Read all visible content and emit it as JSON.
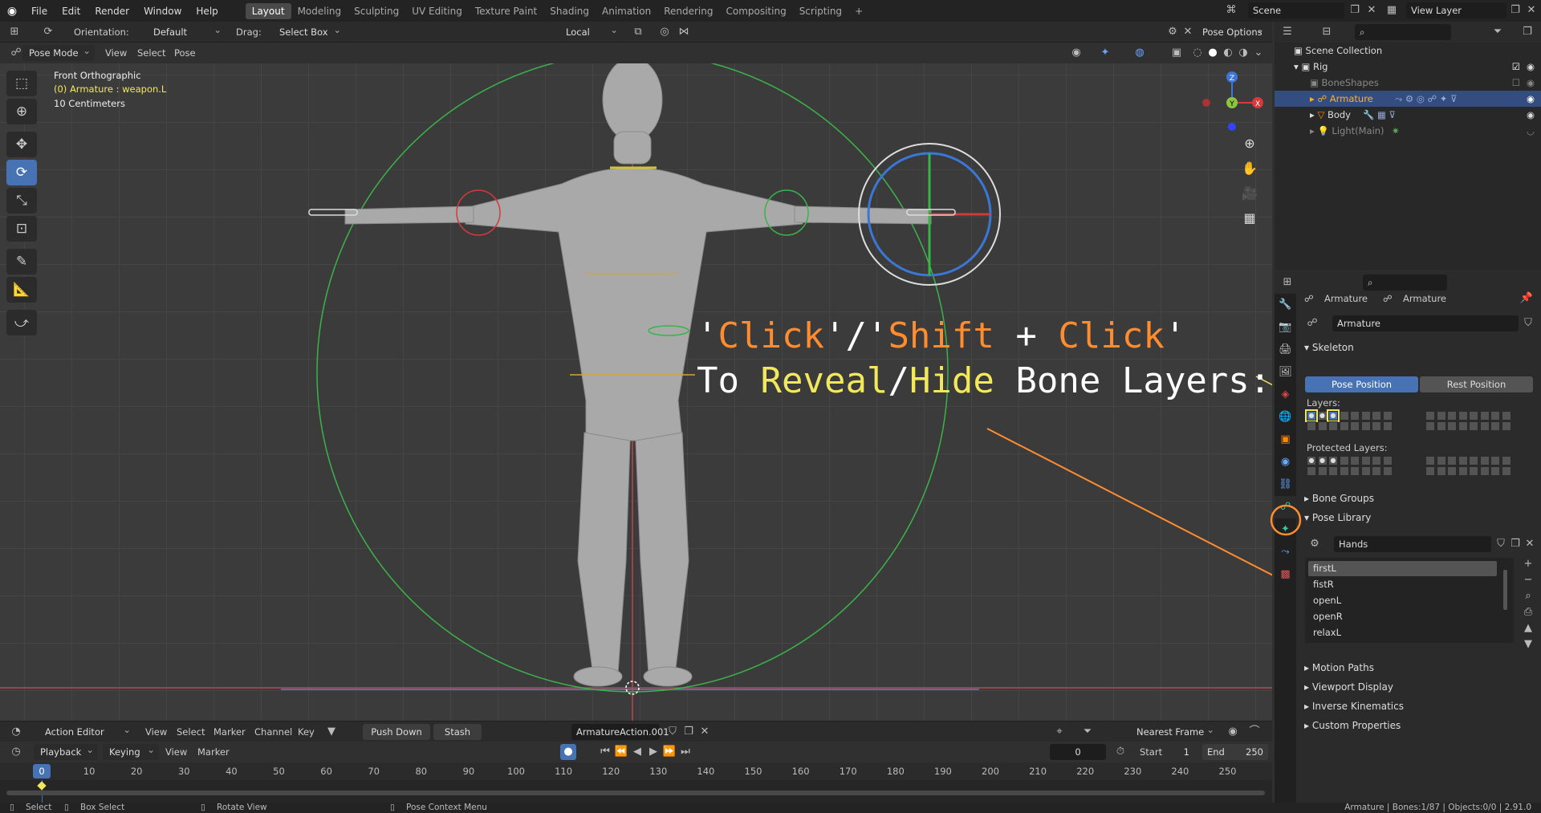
{
  "menu": [
    "File",
    "Edit",
    "Render",
    "Window",
    "Help"
  ],
  "workspaces": [
    "Layout",
    "Modeling",
    "Sculpting",
    "UV Editing",
    "Texture Paint",
    "Shading",
    "Animation",
    "Rendering",
    "Compositing",
    "Scripting"
  ],
  "scene": "Scene",
  "view_layer": "View Layer",
  "header": {
    "orientation_label": "Orientation:",
    "orientation": "Default",
    "drag_label": "Drag:",
    "drag": "Select Box",
    "pivot": "Local",
    "pose_options": "Pose Options"
  },
  "mode": {
    "mode": "Pose Mode",
    "view": "View",
    "select": "Select",
    "pose": "Pose"
  },
  "viewport": {
    "view_name": "Front Orthographic",
    "active": "(0) Armature : weapon.L",
    "scale": "10 Centimeters",
    "gizmo": [
      "Z",
      "Y",
      "X"
    ]
  },
  "annotation": {
    "l1": [
      "'",
      "Click",
      "'/'",
      "Shift",
      " + ",
      "Click",
      "'"
    ],
    "l2": [
      "To ",
      "Reveal",
      "/",
      "Hide",
      " Bone Layers:"
    ]
  },
  "outliner": {
    "root": "Scene Collection",
    "rig": "Rig",
    "boneshapes": "BoneShapes",
    "armature": "Armature",
    "body": "Body",
    "light": "Light(Main)"
  },
  "props": {
    "crumb1": "Armature",
    "crumb2": "Armature",
    "datablock": "Armature",
    "skeleton": "Skeleton",
    "pose_position": "Pose Position",
    "rest_position": "Rest Position",
    "layers": "Layers:",
    "protected": "Protected Layers:",
    "bone_groups": "Bone Groups",
    "pose_library": "Pose Library",
    "library": "Hands",
    "poses": [
      "firstL",
      "fistR",
      "openL",
      "openR",
      "relaxL"
    ],
    "motion_paths": "Motion Paths",
    "viewport_display": "Viewport Display",
    "ik": "Inverse Kinematics",
    "custom_props": "Custom Properties"
  },
  "dope": {
    "editor": "Action Editor",
    "view": "View",
    "select": "Select",
    "marker": "Marker",
    "channel": "Channel",
    "key": "Key",
    "push_down": "Push Down",
    "stash": "Stash",
    "action": "ArmatureAction.001",
    "snap": "Nearest Frame"
  },
  "timeline": {
    "playback": "Playback",
    "keying": "Keying",
    "view": "View",
    "marker": "Marker",
    "current": "0",
    "start_label": "Start",
    "start": "1",
    "end_label": "End",
    "end": "250",
    "ticks": [
      "0",
      "10",
      "20",
      "30",
      "40",
      "50",
      "60",
      "70",
      "80",
      "90",
      "100",
      "110",
      "120",
      "130",
      "140",
      "150",
      "160",
      "170",
      "180",
      "190",
      "200",
      "210",
      "220",
      "230",
      "240",
      "250"
    ]
  },
  "status": {
    "select": "Select",
    "box": "Box Select",
    "rotate": "Rotate View",
    "context": "Pose Context Menu",
    "stats": "Armature | Bones:1/87 | Objects:0/0 | 2.91.0"
  },
  "colors": {
    "accent": "#4772b3",
    "orange": "#ff8c2e",
    "yellow": "#f2e85c"
  }
}
